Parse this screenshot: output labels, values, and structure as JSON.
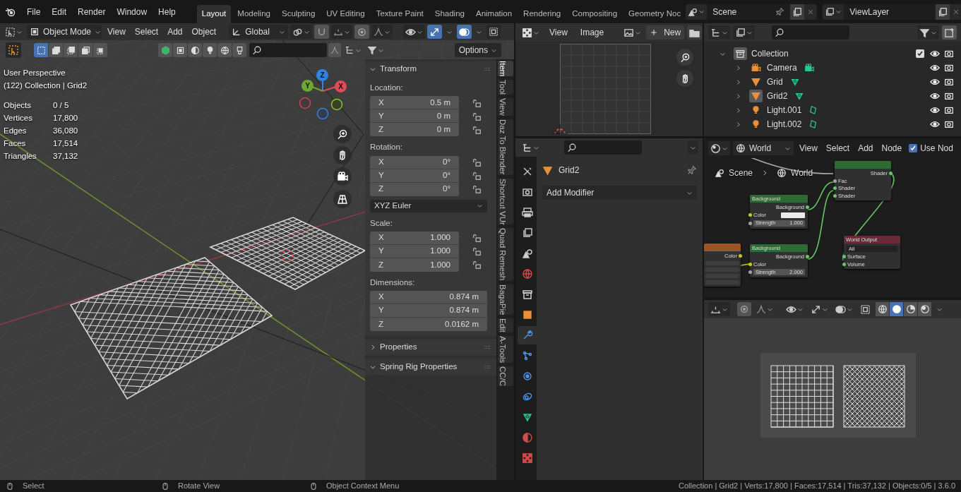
{
  "menu": [
    "File",
    "Edit",
    "Render",
    "Window",
    "Help"
  ],
  "workspaces": [
    {
      "label": "Layout",
      "selected": true
    },
    {
      "label": "Modeling",
      "selected": false
    },
    {
      "label": "Sculpting",
      "selected": false
    },
    {
      "label": "UV Editing",
      "selected": false
    },
    {
      "label": "Texture Paint",
      "selected": false
    },
    {
      "label": "Shading",
      "selected": false
    },
    {
      "label": "Animation",
      "selected": false
    },
    {
      "label": "Rendering",
      "selected": false
    },
    {
      "label": "Compositing",
      "selected": false
    },
    {
      "label": "Geometry Noc",
      "selected": false
    }
  ],
  "scene": "Scene",
  "view_layer": "ViewLayer",
  "viewport": {
    "mode": "Object Mode",
    "menus": [
      "View",
      "Select",
      "Add",
      "Object"
    ],
    "orientation": "Global",
    "toggles": [
      {
        "kind": "snap",
        "on": false
      },
      {
        "kind": "proportional",
        "on": false
      },
      {
        "kind": "gizmos",
        "on": true
      },
      {
        "kind": "overlays",
        "on": true
      }
    ],
    "select_modes": [
      {
        "kind": "new",
        "selected": true
      },
      {
        "kind": "extend",
        "selected": false
      },
      {
        "kind": "subtract",
        "selected": false
      },
      {
        "kind": "difference",
        "selected": false
      },
      {
        "kind": "intersect",
        "selected": false
      }
    ],
    "options": "Options",
    "view_name": "User Perspective",
    "context": "(122) Collection | Grid2",
    "stats": [
      {
        "label": "Objects",
        "value": "0 / 5"
      },
      {
        "label": "Vertices",
        "value": "17,800"
      },
      {
        "label": "Edges",
        "value": "36,080"
      },
      {
        "label": "Faces",
        "value": "17,514"
      },
      {
        "label": "Triangles",
        "value": "37,132"
      }
    ],
    "gizmo": {
      "x": "X",
      "y": "Y",
      "z": "Z"
    },
    "sidebar": {
      "panels": [
        {
          "title": "Transform",
          "expanded": true,
          "sections": [
            {
              "kind": "vector",
              "label": "Location:",
              "fields": [
                {
                  "axis": "X",
                  "value": "0.5 m",
                  "locked": false
                },
                {
                  "axis": "Y",
                  "value": "0 m",
                  "locked": false
                },
                {
                  "axis": "Z",
                  "value": "0 m",
                  "locked": false
                }
              ]
            },
            {
              "kind": "vector",
              "label": "Rotation:",
              "fields": [
                {
                  "axis": "X",
                  "value": "0°",
                  "locked": false
                },
                {
                  "axis": "Y",
                  "value": "0°",
                  "locked": false
                },
                {
                  "axis": "Z",
                  "value": "0°",
                  "locked": false
                }
              ]
            },
            {
              "kind": "dropdown",
              "value": "XYZ Euler"
            },
            {
              "kind": "vector",
              "label": "Scale:",
              "fields": [
                {
                  "axis": "X",
                  "value": "1.000",
                  "locked": false
                },
                {
                  "axis": "Y",
                  "value": "1.000",
                  "locked": false
                },
                {
                  "axis": "Z",
                  "value": "1.000",
                  "locked": false
                }
              ]
            },
            {
              "kind": "vector",
              "label": "Dimensions:",
              "fields": [
                {
                  "axis": "X",
                  "value": "0.874 m"
                },
                {
                  "axis": "Y",
                  "value": "0.874 m"
                },
                {
                  "axis": "Z",
                  "value": "0.0162 m"
                }
              ]
            }
          ]
        },
        {
          "title": "Properties",
          "expanded": false
        },
        {
          "title": "Spring Rig Properties",
          "expanded": true
        }
      ],
      "tabs": [
        {
          "label": "Item",
          "selected": true
        },
        {
          "label": "Tool",
          "selected": false
        },
        {
          "label": "View",
          "selected": false
        },
        {
          "label": "Daz To Blender",
          "selected": false
        },
        {
          "label": "Shortcut VUr",
          "selected": false
        },
        {
          "label": "Quad Remesh",
          "selected": false
        },
        {
          "label": "BagaPie",
          "selected": false
        },
        {
          "label": "Edit",
          "selected": false
        },
        {
          "label": "A-Tools",
          "selected": false
        },
        {
          "label": "CC/C",
          "selected": false
        }
      ]
    }
  },
  "image_editor": {
    "menus": [
      "View",
      "Image"
    ],
    "new": "New"
  },
  "properties": {
    "object": "Grid2",
    "add_modifier": "Add Modifier",
    "tabs": [
      {
        "kind": "tool",
        "selected": false
      },
      {
        "kind": "render",
        "selected": false
      },
      {
        "kind": "output",
        "selected": false
      },
      {
        "kind": "view_layer",
        "selected": false
      },
      {
        "kind": "scene",
        "selected": false
      },
      {
        "kind": "world",
        "selected": false
      },
      {
        "kind": "collection",
        "selected": false
      },
      {
        "kind": "object",
        "selected": false
      },
      {
        "kind": "modifiers",
        "selected": true
      },
      {
        "kind": "particles",
        "selected": false
      },
      {
        "kind": "physics",
        "selected": false
      },
      {
        "kind": "constraints",
        "selected": false
      },
      {
        "kind": "data",
        "selected": false
      },
      {
        "kind": "material",
        "selected": false
      },
      {
        "kind": "texture",
        "selected": false
      }
    ]
  },
  "outliner": {
    "items": [
      {
        "label": "Collection",
        "kind": "collection",
        "selected": true,
        "checked": true,
        "expanded": true,
        "children": [
          {
            "label": "Camera",
            "kind": "camera",
            "selected": false,
            "expanded": false
          },
          {
            "label": "Grid",
            "kind": "mesh",
            "selected": false,
            "expanded": false
          },
          {
            "label": "Grid2",
            "kind": "mesh",
            "selected": true,
            "expanded": false
          },
          {
            "label": "Light.001",
            "kind": "light",
            "selected": false,
            "expanded": false
          },
          {
            "label": "Light.002",
            "kind": "light",
            "selected": false,
            "expanded": false
          }
        ]
      }
    ]
  },
  "node_editor": {
    "world": "World",
    "menus": [
      "View",
      "Select",
      "Add",
      "Node"
    ],
    "use_nodes": {
      "label": "Use Nod",
      "checked": true
    },
    "breadcrumb": [
      {
        "kind": "scene",
        "label": "Scene"
      },
      {
        "kind": "world",
        "label": "World"
      }
    ],
    "nodes": [
      {
        "kind": "shader",
        "outputs": [
          {
            "label": "Shader",
            "kind": "closure"
          }
        ],
        "inputs": [
          {
            "label": "Fac",
            "kind": "scalar"
          },
          {
            "label": "Shader",
            "kind": "closure"
          },
          {
            "label": "Shader",
            "kind": "closure"
          }
        ]
      },
      {
        "kind": "shader",
        "title": "Background",
        "outputs": [
          {
            "label": "Background",
            "kind": "closure"
          }
        ],
        "inputs": [
          {
            "label": "Color",
            "kind": "rgba",
            "swatch": true
          },
          {
            "label": "Strength",
            "kind": "scalar",
            "value": "1.000"
          }
        ]
      },
      {
        "kind": "shader",
        "title": "Background",
        "outputs": [
          {
            "label": "Background",
            "kind": "closure"
          }
        ],
        "inputs": [
          {
            "label": "Color",
            "kind": "rgba"
          },
          {
            "label": "Strength",
            "kind": "scalar",
            "value": "2.000"
          }
        ]
      },
      {
        "kind": "output",
        "title": "World Output",
        "target": "All",
        "inputs": [
          {
            "label": "Surface",
            "kind": "closure"
          },
          {
            "label": "Volume",
            "kind": "closure"
          }
        ]
      },
      {
        "kind": "texture",
        "outputs": [
          {
            "label": "Color",
            "kind": "rgba"
          }
        ]
      }
    ]
  },
  "preview": {
    "shading": [
      {
        "kind": "wireframe",
        "selected": false
      },
      {
        "kind": "solid",
        "selected": true
      },
      {
        "kind": "material",
        "selected": false
      },
      {
        "kind": "rendered",
        "selected": false
      }
    ]
  },
  "status_bar": {
    "hints": [
      "Select",
      "Rotate View",
      "Object Context Menu"
    ],
    "stats": "Collection | Grid2 | Verts:17,800 | Faces:17,514 | Tris:37,132 | Objects:0/5 | 3.6.0"
  }
}
